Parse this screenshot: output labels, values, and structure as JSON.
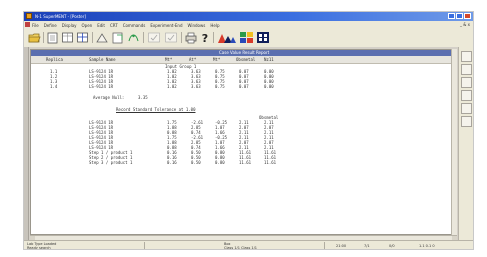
{
  "window": {
    "title": "N-1 SuperMENT - [Poster]"
  },
  "menu": {
    "items": [
      "File",
      "Define",
      "Display",
      "Open",
      "Edit",
      "CRT",
      "Commands",
      "Experiment-End",
      "Windows",
      "Help"
    ],
    "right_label": "_ & x"
  },
  "toolbar": {
    "icons": [
      "open-icon",
      "print-icon",
      "cut-icon",
      "copy-icon",
      "paste-icon",
      "check-icon",
      "print-preview-icon",
      "help-icon",
      "chart-icon",
      "grid-icon"
    ],
    "colors": {
      "red": "#d83a2a",
      "blue": "#2a4ab8",
      "green": "#2a9a4a",
      "navy": "#101e5a",
      "yellow": "#f0c020"
    }
  },
  "report": {
    "header_title": "Case Value Result Report",
    "column_headers": [
      "Replica",
      "Sample Name",
      "Mt*",
      "At*",
      "Mt*",
      "Obsmetal",
      "Nz11"
    ],
    "group_label": "Input Group 1",
    "rows1": [
      [
        "1.1",
        "LS-9124 1R",
        "1.02",
        "3.63",
        "0.75",
        "0.07",
        "0.00"
      ],
      [
        "1.2",
        "LS-9124 1R",
        "1.02",
        "3.63",
        "0.75",
        "0.07",
        "0.00"
      ],
      [
        "1.3",
        "LS-9124 1R",
        "1.02",
        "3.63",
        "0.75",
        "0.07",
        "0.00"
      ],
      [
        "1.4",
        "LS-9124 1R",
        "1.02",
        "3.63",
        "0.75",
        "0.07",
        "0.00"
      ]
    ],
    "average_label": "Average Null:",
    "average_value": "3.35",
    "section_title": "Record Standard Tolerance at 1.00",
    "col2_header": "Obsmetal",
    "rows2": [
      [
        "LS-9124 1R",
        "1.75",
        "-2.61",
        "-0.25",
        "2.11",
        "2.11"
      ],
      [
        "LS-9124 1R",
        "1.88",
        "2.85",
        "1.07",
        "2.07",
        "2.07"
      ],
      [
        "LS-9124 1R",
        "0.88",
        "0.74",
        "1.66",
        "2.11",
        "2.11"
      ],
      [
        "LS-9124 1R",
        "1.75",
        "-2.61",
        "-0.25",
        "2.11",
        "2.11"
      ],
      [
        "LS-9124 1R",
        "1.88",
        "2.85",
        "1.07",
        "2.07",
        "2.07"
      ],
      [
        "LS-9124 1R",
        "0.88",
        "0.74",
        "1.66",
        "2.11",
        "2.11"
      ],
      [
        "Step 1 / product 1",
        "0.16",
        "0.50",
        "0.80",
        "11.61",
        "11.61"
      ],
      [
        "Step 2 / product 1",
        "0.16",
        "0.50",
        "0.80",
        "11.61",
        "11.61"
      ],
      [
        "Step 3 / product 1",
        "0.16",
        "0.50",
        "0.80",
        "11.61",
        "11.61"
      ]
    ]
  },
  "status": {
    "left": "Lab Type Loaded",
    "left2": "Ready search",
    "mid": "Box",
    "mid2": "Class 1/1    Class 1/1",
    "r1": "21:00",
    "r2": "7/1",
    "r3": "0/0",
    "r4": "1.1 0.1 0"
  }
}
